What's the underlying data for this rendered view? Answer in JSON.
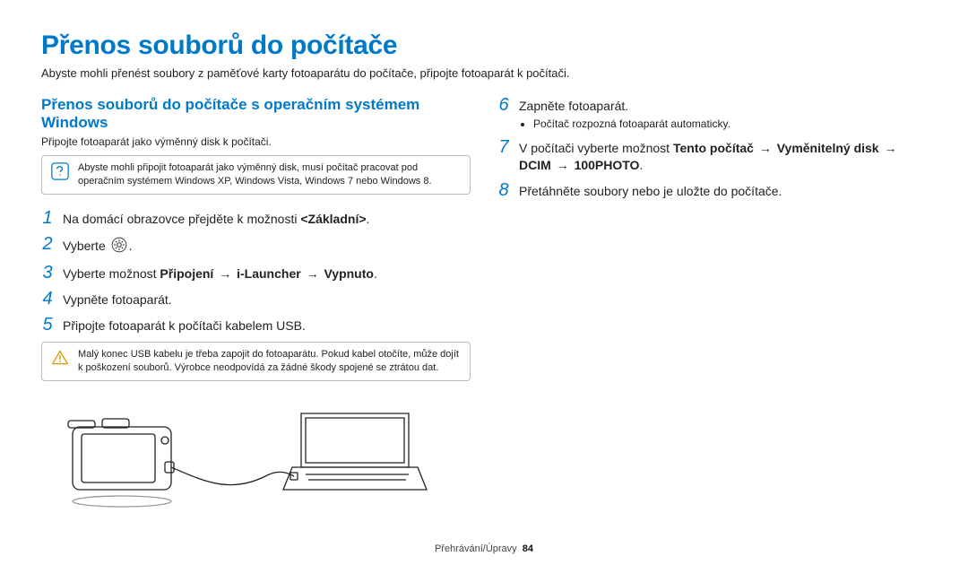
{
  "title": "Přenos souborů do počítače",
  "intro": "Abyste mohli přenést soubory z paměťové karty fotoaparátu do počítače, připojte fotoaparát k počítači.",
  "subheading": "Přenos souborů do počítače s operačním systémem Windows",
  "subintro": "Připojte fotoaparát jako výměnný disk k počítači.",
  "info_note": "Abyste mohli připojit fotoaparát jako výměnný disk, musí počítač pracovat pod operačním systémem Windows XP, Windows Vista, Windows 7 nebo Windows 8.",
  "step1_pre": "Na domácí obrazovce přejděte k možnosti ",
  "step1_bold": "<Základní>",
  "step1_post": ".",
  "step2": "Vyberte ",
  "step2_post": ".",
  "step3_pre": "Vyberte možnost ",
  "step3_b1": "Připojení",
  "step3_b2": "i-Launcher",
  "step3_b3": "Vypnuto",
  "step3_post": ".",
  "step4": "Vypněte fotoaparát.",
  "step5": "Připojte fotoaparát k počítači kabelem USB.",
  "warn_note": "Malý konec USB kabelu je třeba zapojit do fotoaparátu. Pokud kabel otočíte, může dojít k poškození souborů. Výrobce neodpovídá za žádné škody spojené se ztrátou dat.",
  "step6": "Zapněte fotoaparát.",
  "step6_bullet": "Počítač rozpozná fotoaparát automaticky.",
  "step7_pre": "V počítači vyberte možnost ",
  "step7_b1": "Tento počítač",
  "step7_b2": "Vyměnitelný disk",
  "step7_b3": "DCIM",
  "step7_b4": "100PHOTO",
  "step7_post": ".",
  "step8": "Přetáhněte soubory nebo je uložte do počítače.",
  "arrow": "→",
  "footer_section": "Přehrávání/Úpravy",
  "footer_page": "84",
  "icons": {
    "info": "info-icon",
    "warn": "warning-icon",
    "gear": "gear-icon",
    "illustration": "camera-to-laptop-usb"
  }
}
